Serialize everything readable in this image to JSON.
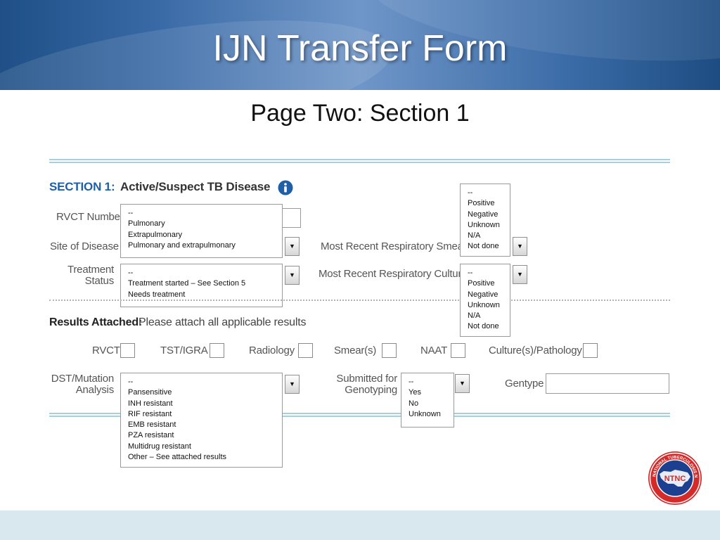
{
  "slide": {
    "title": "IJN Transfer Form",
    "subtitle": "Page Two: Section 1"
  },
  "section": {
    "number_label": "SECTION 1:",
    "title": "Active/Suspect TB Disease",
    "info_icon": "info-icon"
  },
  "labels": {
    "rvct_number": "RVCT Number",
    "site_of_disease": "Site of Disease",
    "treatment_status_1": "Treatment",
    "treatment_status_2": "Status",
    "resp_smear": "Most Recent Respiratory Smear",
    "resp_culture": "Most Recent Respiratory Culture",
    "dst_1": "DST/Mutation",
    "dst_2": "Analysis",
    "genotyping_1": "Submitted for",
    "genotyping_2": "Genotyping",
    "genotype": "Gentype"
  },
  "results": {
    "heading": "Results Attached:",
    "subheading": "Please attach all applicable results",
    "checkboxes": [
      {
        "label": "RVCT"
      },
      {
        "label": "TST/IGRA"
      },
      {
        "label": "Radiology"
      },
      {
        "label": "Smear(s)"
      },
      {
        "label": "NAAT"
      },
      {
        "label": "Culture(s)/Pathology"
      }
    ]
  },
  "dropdowns": {
    "site_of_disease": [
      "--",
      "Pulmonary",
      "Extrapulmonary",
      "Pulmonary and extrapulmonary"
    ],
    "treatment_status": [
      "--",
      "Treatment started – See Section 5",
      "Needs treatment"
    ],
    "resp_smear": [
      "--",
      "Positive",
      "Negative",
      "Unknown",
      "N/A",
      "Not done"
    ],
    "resp_culture": [
      "--",
      "Positive",
      "Negative",
      "Unknown",
      "N/A",
      "Not done"
    ],
    "dst_analysis": [
      "--",
      "Pansensitive",
      "INH resistant",
      "RIF resistant",
      "EMB resistant",
      "PZA resistant",
      "Multidrug resistant",
      "Other – See attached results"
    ],
    "genotyping": [
      "--",
      "Yes",
      "No",
      "Unknown"
    ]
  },
  "dropdown_arrow": "▼",
  "logo": {
    "text": "NTNC",
    "ring_text": "NATIONAL TUBERCULOSIS NURSE COALITION",
    "icon": "ntnc-logo-icon"
  },
  "colors": {
    "banner": "#3a6aa6",
    "section_blue": "#1f5fa8",
    "accent_line": "#a8d0dc",
    "footer": "#d9e8ee",
    "logo_red": "#d42a2a",
    "logo_blue": "#1d3f8f"
  }
}
